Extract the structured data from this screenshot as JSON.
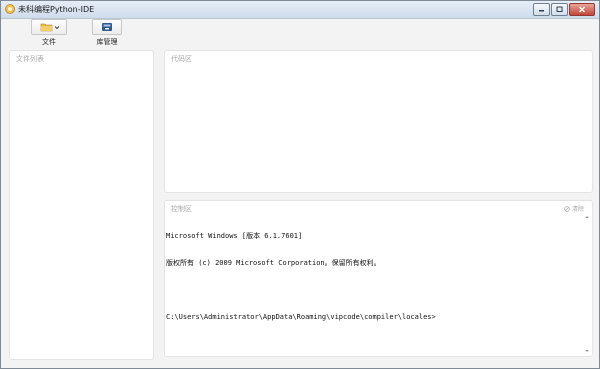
{
  "window": {
    "title": "未科编程Python-IDE"
  },
  "toolbar": {
    "file_label": "文件",
    "library_label": "库管理"
  },
  "panels": {
    "file_list_title": "文件列表",
    "code_title": "代码区",
    "console_title": "控制区",
    "clear_label": "清除"
  },
  "console": {
    "lines": [
      "Microsoft Windows [版本 6.1.7601]",
      "版权所有 (c) 2009 Microsoft Corporation。保留所有权利。",
      "",
      "C:\\Users\\Administrator\\AppData\\Roaming\\vipcode\\compiler\\locales>"
    ]
  },
  "icons": {
    "app": "app-icon",
    "folder": "folder-icon",
    "library": "library-icon",
    "clear": "clear-icon"
  },
  "colors": {
    "close_button": "#c4453a",
    "titlebar": "#cfdceb",
    "folder": "#e8b84a",
    "library": "#2f5a8c"
  }
}
